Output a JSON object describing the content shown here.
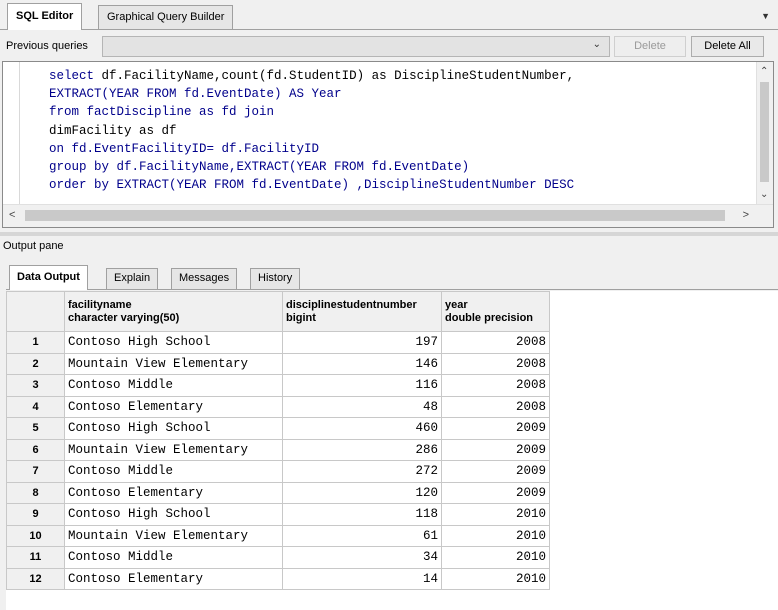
{
  "tabs": {
    "sql_editor": "SQL Editor",
    "graphical_query_builder": "Graphical Query Builder"
  },
  "previous_queries": {
    "label": "Previous queries",
    "selected": "",
    "delete_label": "Delete",
    "delete_all_label": "Delete All"
  },
  "editor": {
    "lines": [
      "select df.FacilityName,count(fd.StudentID) as DisciplineStudentNumber,",
      "EXTRACT(YEAR FROM fd.EventDate) AS Year",
      "from factDiscipline as fd join",
      "dimFacility as df",
      "on fd.EventFacilityID= df.FacilityID",
      "group by df.FacilityName,EXTRACT(YEAR FROM fd.EventDate)",
      "order by EXTRACT(YEAR FROM fd.EventDate) ,DisciplineStudentNumber DESC"
    ]
  },
  "output": {
    "title": "Output pane",
    "tabs": [
      "Data Output",
      "Explain",
      "Messages",
      "History"
    ],
    "columns": [
      {
        "name": "facilityname",
        "type": "character varying(50)"
      },
      {
        "name": "disciplinestudentnumber",
        "type": "bigint"
      },
      {
        "name": "year",
        "type": "double precision"
      }
    ],
    "rows": [
      {
        "n": "1",
        "facility": "Contoso High School",
        "count": "197",
        "year": "2008"
      },
      {
        "n": "2",
        "facility": "Mountain View Elementary",
        "count": "146",
        "year": "2008"
      },
      {
        "n": "3",
        "facility": "Contoso Middle",
        "count": "116",
        "year": "2008"
      },
      {
        "n": "4",
        "facility": "Contoso Elementary",
        "count": "48",
        "year": "2008"
      },
      {
        "n": "5",
        "facility": "Contoso High School",
        "count": "460",
        "year": "2009"
      },
      {
        "n": "6",
        "facility": "Mountain View Elementary",
        "count": "286",
        "year": "2009"
      },
      {
        "n": "7",
        "facility": "Contoso Middle",
        "count": "272",
        "year": "2009"
      },
      {
        "n": "8",
        "facility": "Contoso Elementary",
        "count": "120",
        "year": "2009"
      },
      {
        "n": "9",
        "facility": "Contoso High School",
        "count": "118",
        "year": "2010"
      },
      {
        "n": "10",
        "facility": "Mountain View Elementary",
        "count": "61",
        "year": "2010"
      },
      {
        "n": "11",
        "facility": "Contoso Middle",
        "count": "34",
        "year": "2010"
      },
      {
        "n": "12",
        "facility": "Contoso Elementary",
        "count": "14",
        "year": "2010"
      }
    ]
  },
  "icons": {
    "tab_menu": "dropdown-menu-icon",
    "select_chevron": "chevron-down-icon",
    "scroll_up": "scroll-up-icon",
    "scroll_down": "scroll-down-icon",
    "scroll_left": "scroll-left-icon",
    "scroll_right": "scroll-right-icon"
  },
  "colors": {
    "keyword": "#00008b",
    "grid_header_bg": "#f0f0f0",
    "editor_bg": "#ffffff"
  }
}
